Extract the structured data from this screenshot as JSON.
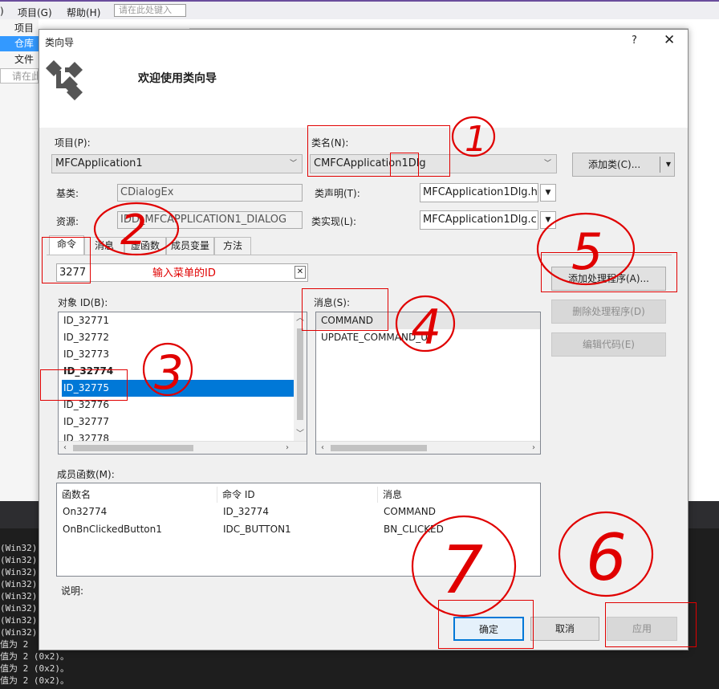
{
  "background_ide": {
    "menu": [
      "项目(G)",
      "帮助(H)"
    ],
    "search_placeholder": "请在此处键入",
    "left_items": [
      "项目",
      "仓库",
      "文件",
      "请在此"
    ],
    "output_lines": [
      "(Win32):",
      "(Win32):",
      "(Win32):",
      "(Win32):",
      "(Win32):",
      "(Win32):",
      "(Win32):",
      "(Win32):",
      "值为 2",
      "值为 2 (0x2)。",
      "值为 2 (0x2)。",
      "值为 2 (0x2)。"
    ]
  },
  "dialog": {
    "title": "类向导",
    "help": "?",
    "close": "✕",
    "heading": "欢迎使用类向导",
    "project_label": "项目(P):",
    "project_value": "MFCApplication1",
    "classname_label": "类名(N):",
    "classname_value": "CMFCApplication1Dlg",
    "add_class_button": "添加类(C)...",
    "base_label": "基类:",
    "base_value": "CDialogEx",
    "decl_label": "类声明(T):",
    "decl_value": "MFCApplication1Dlg.h",
    "resource_label": "资源:",
    "resource_value": "IDD_MFCAPPLICATION1_DIALOG",
    "impl_label": "类实现(L):",
    "impl_value": "MFCApplication1Dlg.cpp",
    "tabs": [
      "命令",
      "消息",
      "虚函数",
      "成员变量",
      "方法"
    ],
    "search_value": "3277",
    "search_clear": "✕",
    "object_id_label": "对象 ID(B):",
    "object_ids": [
      "ID_32771",
      "ID_32772",
      "ID_32773",
      "ID_32774",
      "ID_32775",
      "ID_32776",
      "ID_32777",
      "ID_32778"
    ],
    "selected_object_index": 4,
    "messages_label": "消息(S):",
    "messages": [
      "COMMAND",
      "UPDATE_COMMAND_UI"
    ],
    "add_handler_button": "添加处理程序(A)...",
    "delete_handler_button": "删除处理程序(D)",
    "edit_code_button": "编辑代码(E)",
    "member_label": "成员函数(M):",
    "member_columns": [
      "函数名",
      "命令 ID",
      "消息"
    ],
    "member_rows": [
      [
        "On32774",
        "ID_32774",
        "COMMAND"
      ],
      [
        "OnBnClickedButton1",
        "IDC_BUTTON1",
        "BN_CLICKED"
      ]
    ],
    "description_label": "说明:",
    "ok_button": "确定",
    "cancel_button": "取消",
    "apply_button": "应用"
  },
  "annotations": {
    "id_hint": "输入菜单的ID",
    "numbers": [
      "1",
      "2",
      "3",
      "4",
      "5",
      "6",
      "7"
    ],
    "color": "#e00000"
  },
  "colors": {
    "selection": "#0078d7",
    "dialog_bg": "#f0f0f0",
    "accent": "#6a4c9c"
  }
}
